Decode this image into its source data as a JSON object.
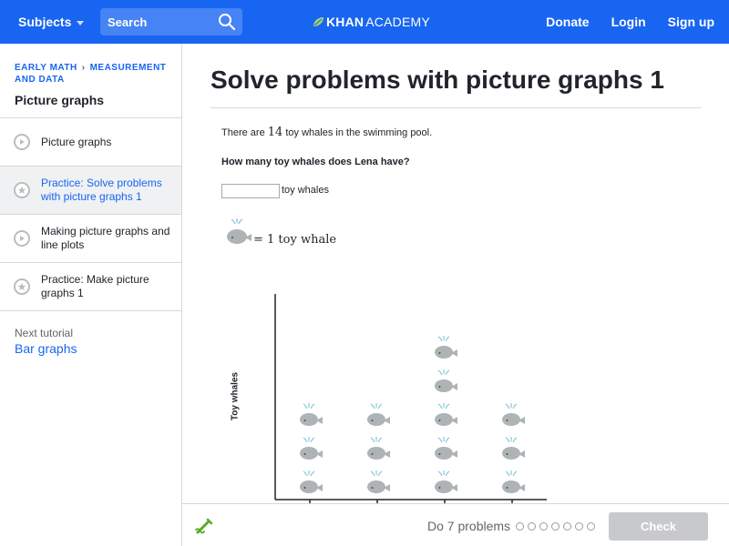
{
  "header": {
    "subjects_label": "Subjects",
    "search_placeholder": "Search",
    "logo_bold": "KHAN",
    "logo_regular": "ACADEMY",
    "donate": "Donate",
    "login": "Login",
    "signup": "Sign up",
    "brand_color": "#1865f2"
  },
  "sidebar": {
    "breadcrumb": [
      "EARLY MATH",
      "MEASUREMENT AND DATA"
    ],
    "title": "Picture graphs",
    "items": [
      {
        "label": "Picture graphs",
        "icon": "play-icon",
        "active": false
      },
      {
        "label": "Practice: Solve problems with picture graphs 1",
        "icon": "star-icon",
        "active": true
      },
      {
        "label": "Making picture graphs and line plots",
        "icon": "play-icon",
        "active": false
      },
      {
        "label": "Practice: Make picture graphs 1",
        "icon": "star-icon",
        "active": false
      }
    ],
    "next_label": "Next tutorial",
    "next_link": "Bar graphs"
  },
  "main": {
    "title": "Solve problems with picture graphs 1",
    "statement_pre": "There are",
    "statement_num": "14",
    "statement_post": "toy whales in the swimming pool.",
    "question": "How many toy whales does Lena have?",
    "answer_value": "",
    "unit": "toy whales",
    "legend": "= 1 toy whale",
    "y_axis_label": "Toy whales"
  },
  "chart_data": {
    "type": "picture",
    "ylabel": "Toy whales",
    "categories": [
      "",
      "",
      "",
      ""
    ],
    "values": [
      3,
      3,
      5,
      3
    ],
    "symbol": "whale",
    "symbol_value": 1
  },
  "footer": {
    "do_text": "Do 7 problems",
    "problem_count": 7,
    "check_label": "Check"
  }
}
